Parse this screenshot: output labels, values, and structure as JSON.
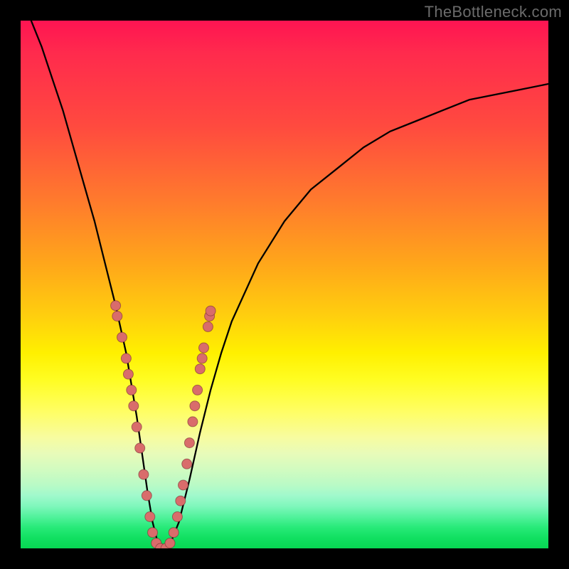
{
  "branding": {
    "watermark": "TheBottleneck.com"
  },
  "colors": {
    "gradient_top": "#ff1452",
    "gradient_mid": "#fff000",
    "gradient_bottom": "#07d853",
    "curve": "#000000",
    "dots": "#d96c6b",
    "frame": "#000000"
  },
  "chart_data": {
    "type": "line",
    "title": "",
    "xlabel": "",
    "ylabel": "",
    "xlim": [
      0,
      100
    ],
    "ylim": [
      0,
      100
    ],
    "series": [
      {
        "name": "bottleneck-curve",
        "x": [
          2,
          4,
          6,
          8,
          10,
          12,
          14,
          16,
          18,
          20,
          22,
          23,
          24,
          25,
          26,
          27,
          28,
          30,
          32,
          34,
          36,
          38,
          40,
          45,
          50,
          55,
          60,
          65,
          70,
          75,
          80,
          85,
          90,
          95,
          100
        ],
        "y": [
          100,
          95,
          89,
          83,
          76,
          69,
          62,
          54,
          46,
          37,
          25,
          18,
          11,
          5,
          1,
          0,
          0,
          5,
          13,
          22,
          30,
          37,
          43,
          54,
          62,
          68,
          72,
          76,
          79,
          81,
          83,
          85,
          86,
          87,
          88
        ]
      }
    ],
    "markers": {
      "name": "sample-points",
      "points": [
        {
          "x": 18.0,
          "y": 46
        },
        {
          "x": 18.3,
          "y": 44
        },
        {
          "x": 19.2,
          "y": 40
        },
        {
          "x": 20.0,
          "y": 36
        },
        {
          "x": 20.4,
          "y": 33
        },
        {
          "x": 21.0,
          "y": 30
        },
        {
          "x": 21.4,
          "y": 27
        },
        {
          "x": 22.0,
          "y": 23
        },
        {
          "x": 22.6,
          "y": 19
        },
        {
          "x": 23.3,
          "y": 14
        },
        {
          "x": 23.9,
          "y": 10
        },
        {
          "x": 24.5,
          "y": 6
        },
        {
          "x": 25.0,
          "y": 3
        },
        {
          "x": 25.7,
          "y": 1
        },
        {
          "x": 26.5,
          "y": 0
        },
        {
          "x": 27.5,
          "y": 0
        },
        {
          "x": 28.3,
          "y": 1
        },
        {
          "x": 29.0,
          "y": 3
        },
        {
          "x": 29.7,
          "y": 6
        },
        {
          "x": 30.3,
          "y": 9
        },
        {
          "x": 30.8,
          "y": 12
        },
        {
          "x": 31.5,
          "y": 16
        },
        {
          "x": 32.0,
          "y": 20
        },
        {
          "x": 32.6,
          "y": 24
        },
        {
          "x": 33.0,
          "y": 27
        },
        {
          "x": 33.5,
          "y": 30
        },
        {
          "x": 34.0,
          "y": 34
        },
        {
          "x": 34.4,
          "y": 36
        },
        {
          "x": 34.7,
          "y": 38
        },
        {
          "x": 35.5,
          "y": 42
        },
        {
          "x": 35.8,
          "y": 44
        },
        {
          "x": 36.0,
          "y": 45
        }
      ]
    }
  }
}
